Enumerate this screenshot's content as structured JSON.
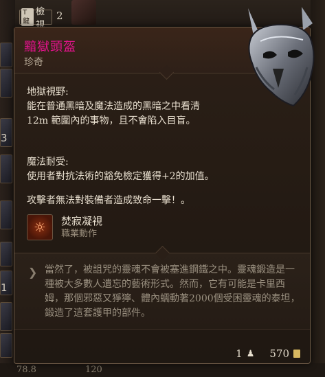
{
  "background": {
    "top_button_key": "T鍵",
    "top_button_label": "檢視",
    "top_count": "2",
    "left_numbers": [
      "3",
      "1"
    ],
    "bottom_left_text": "78.8",
    "bottom_mid_text": "120"
  },
  "tooltip": {
    "item_name": "黯獄頭盔",
    "rarity": "珍奇",
    "abilities": [
      {
        "title": "地獄視野:",
        "text": "能在普通黑暗及魔法造成的黑暗之中看清 12m 範圍內的事物，且不會陷入目盲。"
      },
      {
        "title": "魔法耐受:",
        "text": "使用者對抗法術的豁免檢定獲得+2的加值。"
      }
    ],
    "crit_line": "攻擊者無法對裝備者造成致命一擊！。",
    "action": {
      "name": "焚寂凝視",
      "type": "職業動作"
    },
    "lore": "當然了，被詛咒的靈魂不會被塞進鋼鐵之中。靈魂鍛造是一種被大多數人遺忘的藝術形式。然而，它有可能是卡里西姆，那個邪惡又猙獰、體內蠕動著2000個受困靈魂的泰坦，鍛造了這套護甲的部件。",
    "weight": "1",
    "value": "570"
  },
  "colors": {
    "item_name": "#e0138a",
    "panel_border": "#6d5a46",
    "lore_text": "#9a9080"
  }
}
